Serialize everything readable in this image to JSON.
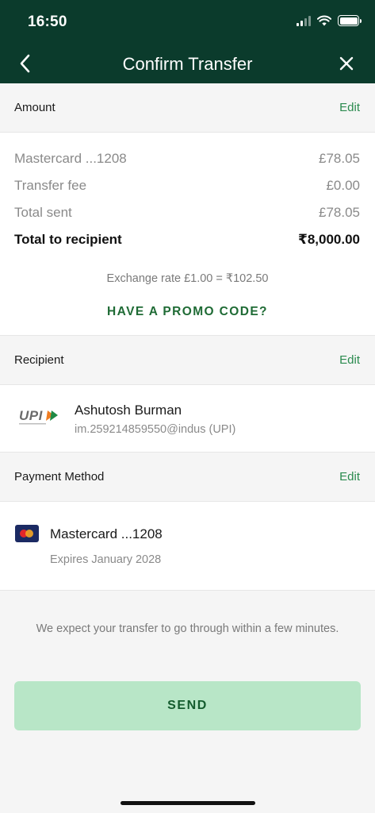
{
  "status_bar": {
    "time": "16:50"
  },
  "header": {
    "title": "Confirm Transfer",
    "back_icon": "chevron-left-icon",
    "close_icon": "close-icon"
  },
  "amount_section": {
    "label": "Amount",
    "edit_label": "Edit",
    "rows": [
      {
        "label": "Mastercard ...1208",
        "value": "£78.05"
      },
      {
        "label": "Transfer fee",
        "value": "£0.00"
      },
      {
        "label": "Total sent",
        "value": "£78.05"
      },
      {
        "label": "Total to recipient",
        "value": "₹8,000.00"
      }
    ],
    "exchange_rate": "Exchange rate £1.00 = ₹102.50",
    "promo_label": "HAVE A PROMO CODE?"
  },
  "recipient_section": {
    "label": "Recipient",
    "edit_label": "Edit",
    "logo_text": "UPI",
    "name": "Ashutosh Burman",
    "id": "im.259214859550@indus (UPI)"
  },
  "payment_section": {
    "label": "Payment Method",
    "edit_label": "Edit",
    "card_name": "Mastercard ...1208",
    "expires": "Expires January 2028"
  },
  "footer": {
    "expect_text": "We expect your transfer to go through within a few minutes.",
    "send_label": "SEND"
  },
  "colors": {
    "header_bg": "#0b3b2c",
    "accent_green": "#2a8a4e",
    "send_button_bg": "#b8e6c7"
  }
}
